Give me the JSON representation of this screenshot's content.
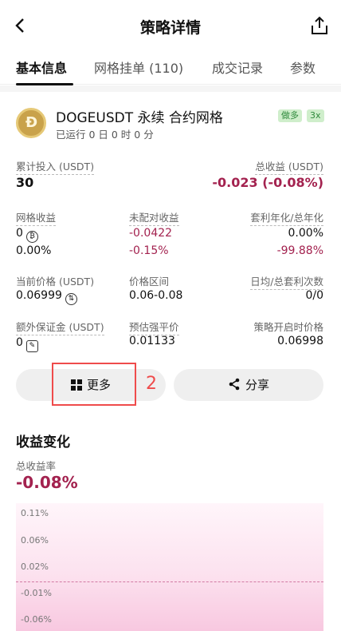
{
  "header": {
    "title": "策略详情"
  },
  "tabs": [
    {
      "label": "基本信息"
    },
    {
      "label": "网格挂单 (110)"
    },
    {
      "label": "成交记录"
    },
    {
      "label": "参数"
    }
  ],
  "strategy": {
    "pair": "DOGEUSDT 永续 合约网格",
    "runtime": "已运行 0 日 0 时 0 分",
    "badges": [
      "做多",
      "3x"
    ]
  },
  "stats": {
    "invest_label": "累计投入 (USDT)",
    "invest_value": "30",
    "total_profit_label": "总收益 (USDT)",
    "total_profit_value": "-0.023 (-0.08%)",
    "grid_profit_label": "网格收益",
    "grid_profit_value": "0",
    "grid_profit_pct": "0.00%",
    "unmatched_label": "未配对收益",
    "unmatched_value": "-0.0422",
    "unmatched_pct": "-0.15%",
    "apr_label": "套利年化/总年化",
    "apr_value1": "0.00%",
    "apr_value2": "-99.88%",
    "price_label": "当前价格 (USDT)",
    "price_value": "0.06999",
    "range_label": "价格区间",
    "range_value": "0.06-0.08",
    "arb_count_label": "日均/总套利次数",
    "arb_count_value": "0/0",
    "margin_label": "额外保证金 (USDT)",
    "margin_value": "0",
    "liq_label": "预估强平价",
    "liq_value": "0.01133",
    "start_price_label": "策略开启时价格",
    "start_price_value": "0.06998"
  },
  "buttons": {
    "more": "更多",
    "share": "分享"
  },
  "annotation": {
    "number": "2"
  },
  "chart_section": {
    "title": "收益变化",
    "rate_label": "总收益率",
    "rate_value": "-0.08%"
  },
  "chart_data": {
    "type": "area",
    "y_ticks": [
      "0.11%",
      "0.06%",
      "0.02%",
      "-0.01%",
      "-0.06%"
    ],
    "values": [
      -0.08
    ],
    "ylim": [
      -0.08,
      0.13
    ]
  },
  "colors": {
    "negative": "#a3224f",
    "accent_box": "#ef4b4b",
    "area_fill": "#f8c8e0"
  }
}
